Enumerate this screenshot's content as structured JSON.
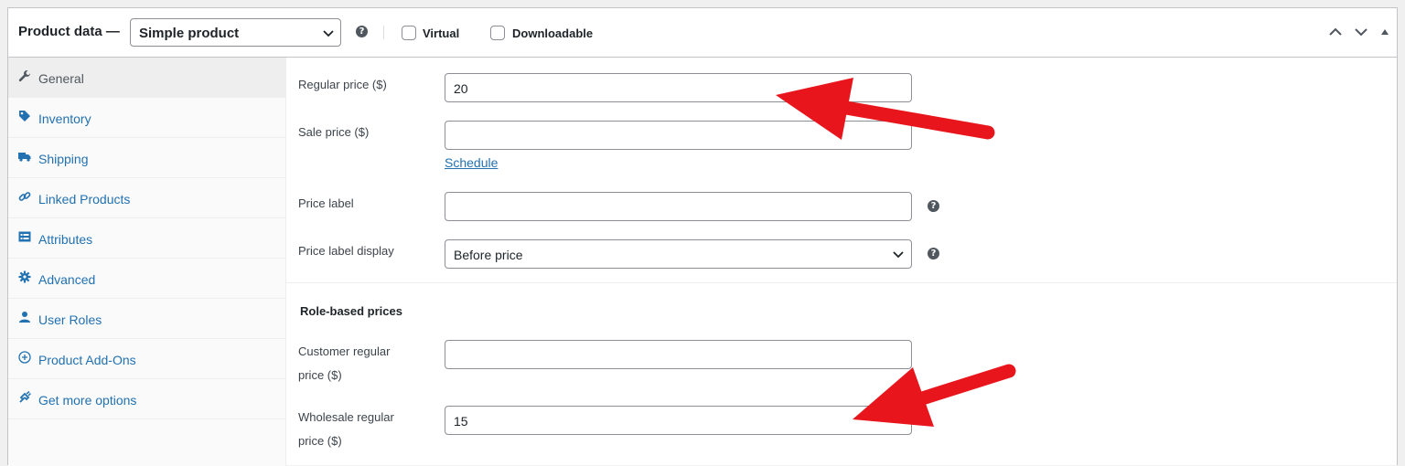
{
  "header": {
    "title": "Product data —",
    "product_type": "Simple product",
    "help": "?",
    "virtual_label": "Virtual",
    "downloadable_label": "Downloadable"
  },
  "sidebar": {
    "items": [
      {
        "label": "General",
        "icon": "wrench-icon",
        "active": true
      },
      {
        "label": "Inventory",
        "icon": "tag-icon"
      },
      {
        "label": "Shipping",
        "icon": "truck-icon"
      },
      {
        "label": "Linked Products",
        "icon": "link-icon"
      },
      {
        "label": "Attributes",
        "icon": "list-icon"
      },
      {
        "label": "Advanced",
        "icon": "gear-icon"
      },
      {
        "label": "User Roles",
        "icon": "user-icon"
      },
      {
        "label": "Product Add-Ons",
        "icon": "plus-circle-icon"
      },
      {
        "label": "Get more options",
        "icon": "plugin-icon"
      }
    ]
  },
  "general": {
    "regular_price_label": "Regular price ($)",
    "regular_price_value": "20",
    "sale_price_label": "Sale price ($)",
    "sale_price_value": "",
    "schedule_link": "Schedule",
    "price_label_label": "Price label",
    "price_label_value": "",
    "price_label_display_label": "Price label display",
    "price_label_display_value": "Before price"
  },
  "role_prices": {
    "title": "Role-based prices",
    "customer_label_1": "Customer regular",
    "customer_label_2": "price ($)",
    "customer_value": "",
    "wholesale_label_1": "Wholesale regular",
    "wholesale_label_2": "price ($)",
    "wholesale_value": "15"
  },
  "colors": {
    "accent": "#2271b1",
    "annotation_arrow": "#e8161c"
  }
}
